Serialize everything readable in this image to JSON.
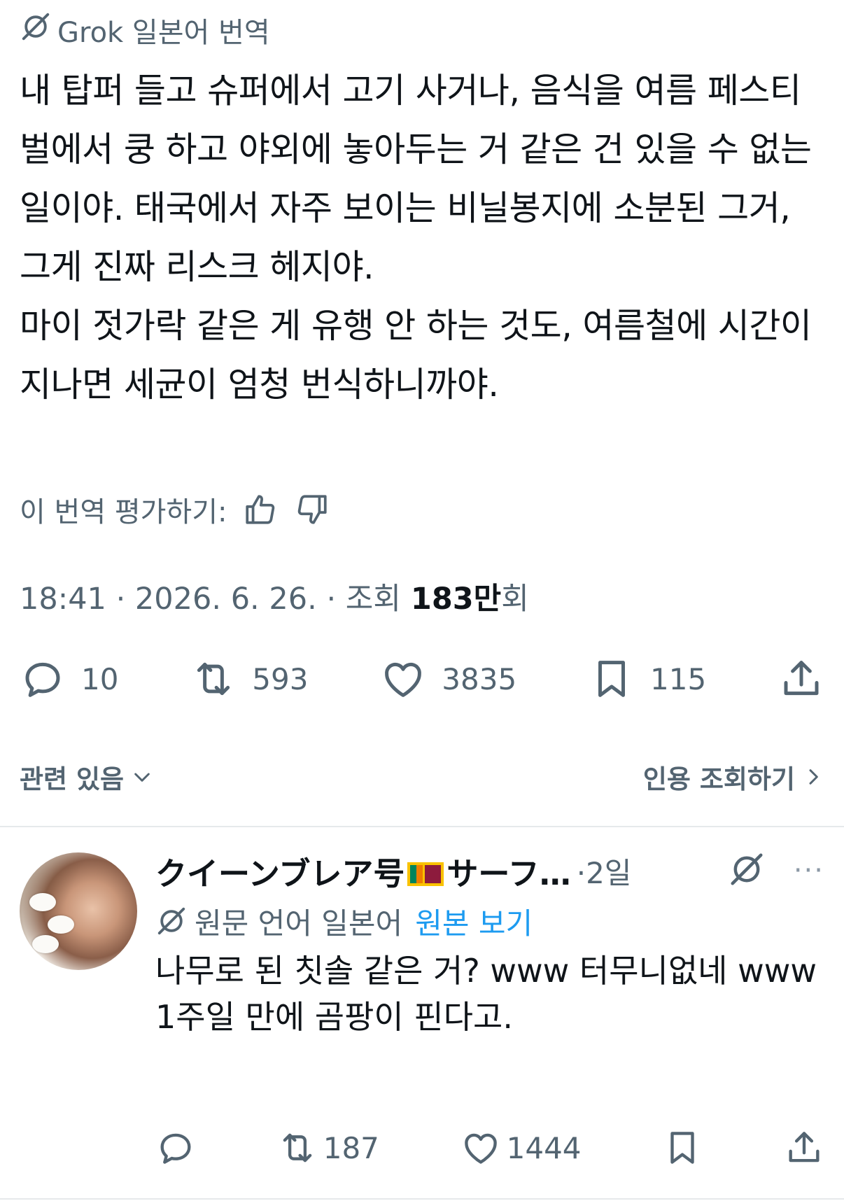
{
  "translation": {
    "header": "Grok 일본어 번역",
    "body": "내 탑퍼 들고 슈퍼에서 고기 사거나, 음식을 여름 페스티벌에서 쿵 하고 야외에 놓아두는 거 같은 건 있을 수 없는 일이야. 태국에서 자주 보이는 비닐봉지에 소분된 그거, 그게 진짜 리스크 헤지야.\n마이 젓가락 같은 게 유행 안 하는 것도, 여름철에 시간이 지나면 세균이 엄청 번식하니까야.",
    "rate_label": "이 번역 평가하기:"
  },
  "meta": {
    "time": "18:41 · 2026. 6. 26. · 조회 ",
    "views_number": "183만",
    "views_suffix": "회"
  },
  "actions": {
    "replies": "10",
    "reposts": "593",
    "likes": "3835",
    "bookmarks": "115"
  },
  "related": {
    "left": "관련 있음",
    "right": "인용 조회하기"
  },
  "reply": {
    "name": "クイーンブレア号",
    "name_after_flag": "サーフ…",
    "time": "·2일",
    "more": "···",
    "lang_label": "원문 언어 일본어",
    "view_original": "원본 보기",
    "text": "나무로 된 칫솔 같은 거? www 터무니없네 www\n1주일 만에 곰팡이 핀다고.",
    "reposts": "187",
    "likes": "1444"
  },
  "colors": {
    "text": "#0f1419",
    "secondary": "#536471",
    "accent": "#1d9bf0",
    "divider": "#e6e9eb"
  }
}
